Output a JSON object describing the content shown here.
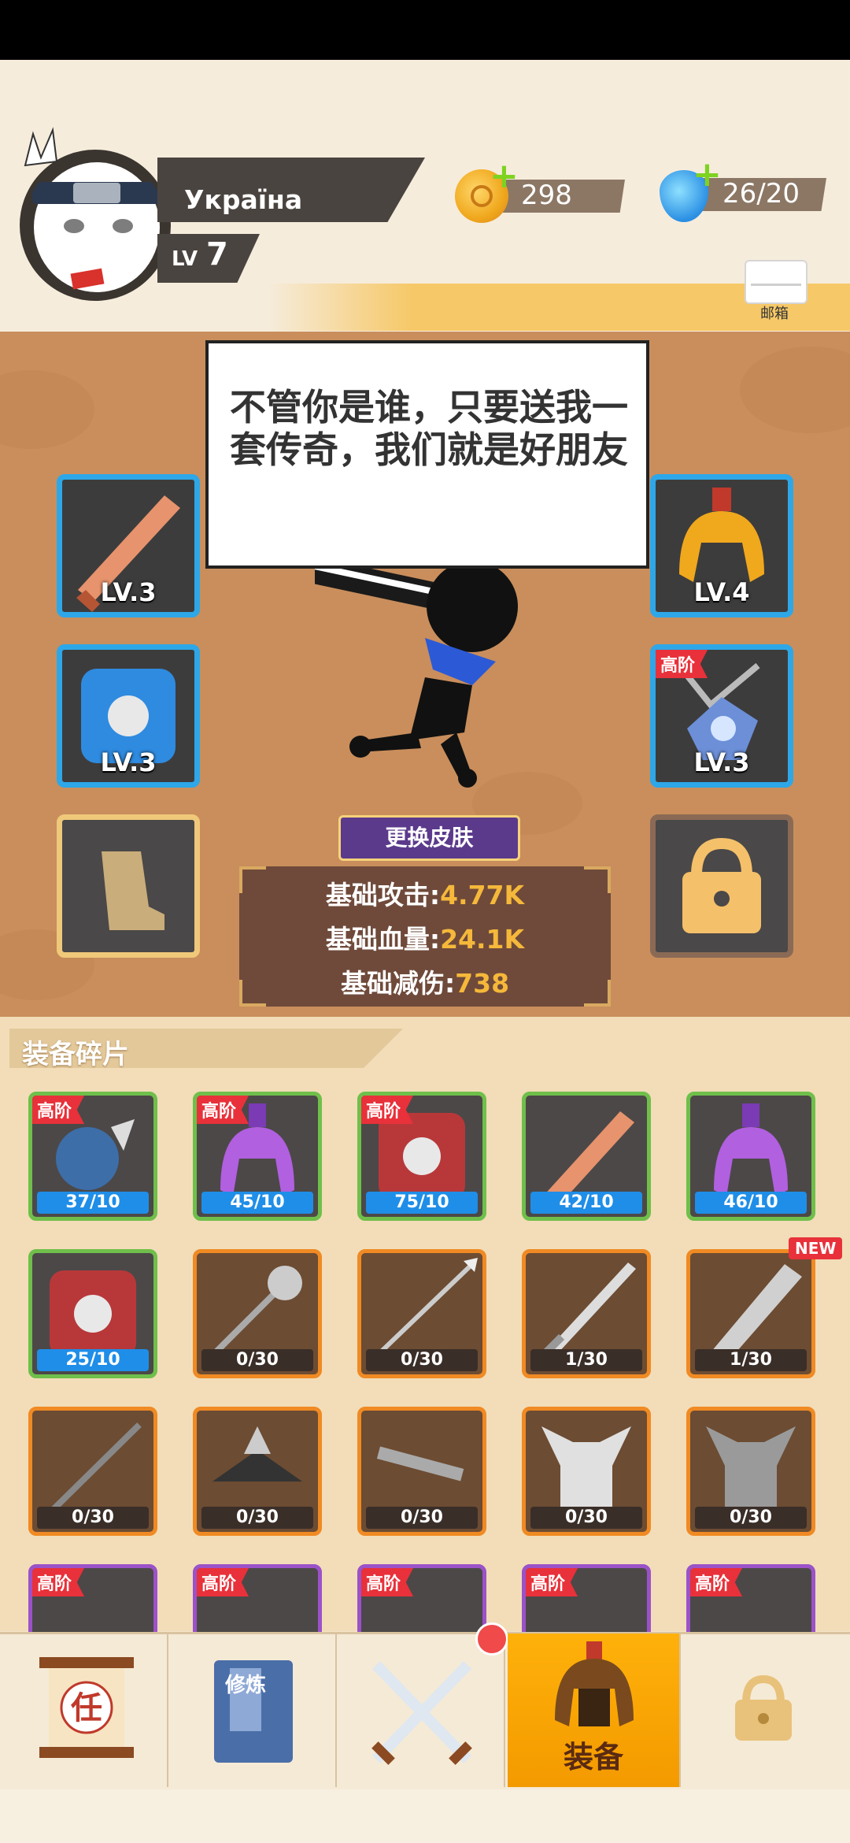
{
  "player": {
    "name": "Україна",
    "lv_label": "LV",
    "level": "7"
  },
  "resources": {
    "coins": "298",
    "energy": "26/20"
  },
  "mail": {
    "label": "邮箱"
  },
  "dialog": {
    "text": "不管你是谁，只要送我一套传奇，我们就是好朋友"
  },
  "equipment": {
    "weapon_lv": "LV.3",
    "helmet_lv": "LV.4",
    "armor_lv": "LV.3",
    "necklace_lv": "LV.3",
    "necklace_tag": "高阶"
  },
  "skin_button": "更换皮肤",
  "stats": {
    "atk_label": "基础攻击:",
    "atk_value": "4.77K",
    "hp_label": "基础血量:",
    "hp_value": "24.1K",
    "def_label": "基础减伤:",
    "def_value": "738"
  },
  "fragments": {
    "title": "装备碎片",
    "high_tag": "高阶",
    "new_tag": "NEW",
    "row1": [
      "37/10",
      "45/10",
      "75/10",
      "42/10",
      "46/10"
    ],
    "row2": [
      "25/10",
      "0/30",
      "0/30",
      "1/30",
      "1/30"
    ],
    "row3": [
      "0/30",
      "0/30",
      "0/30",
      "0/30",
      "0/30"
    ]
  },
  "tabs": {
    "equip_label": "装备",
    "task_char": "任",
    "cultivate_chars": "修炼"
  },
  "colors": {
    "accent": "#f5b83a",
    "tab_active": "#ffa70a",
    "slot_blue": "#2ea7e8"
  }
}
